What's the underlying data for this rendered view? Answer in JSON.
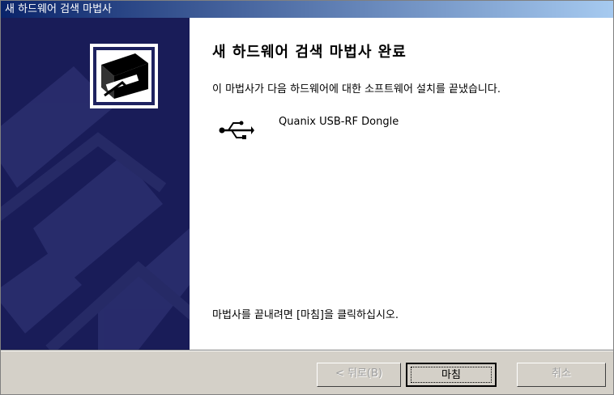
{
  "window": {
    "title": "새 하드웨어 검색 마법사"
  },
  "content": {
    "heading": "새 하드웨어 검색 마법사 완료",
    "description": "이 마법사가 다음 하드웨어에 대한 소프트웨어 설치를 끝냈습니다.",
    "device_name": "Quanix USB-RF Dongle",
    "device_icon": "usb-icon",
    "finish_instruction": "마법사를 끝내려면 [마침]을 클릭하십시오."
  },
  "side_panel": {
    "icon": "hardware-install-icon"
  },
  "buttons": {
    "back": "< 뒤로(B)",
    "finish": "마침",
    "cancel": "취소"
  },
  "colors": {
    "titlebar_start": "#0a246a",
    "titlebar_end": "#a6caf0",
    "side_panel": "#191c58"
  }
}
